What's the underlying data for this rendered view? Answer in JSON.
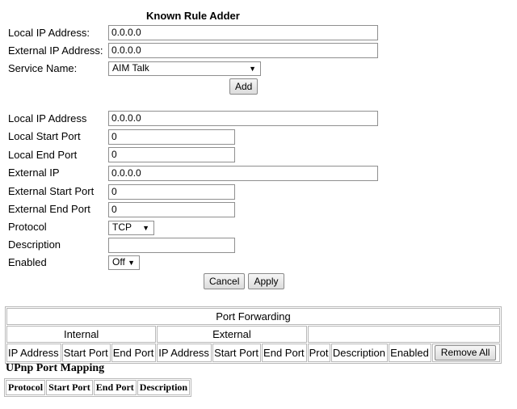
{
  "known_rule": {
    "title": "Known Rule Adder",
    "local_ip_label": "Local IP Address:",
    "local_ip_value": "0.0.0.0",
    "external_ip_label": "External IP Address:",
    "external_ip_value": "0.0.0.0",
    "service_label": "Service Name:",
    "service_value": "AIM Talk",
    "add_label": "Add"
  },
  "custom_rule": {
    "local_ip_label": "Local IP Address",
    "local_ip_value": "0.0.0.0",
    "local_start_label": "Local Start Port",
    "local_start_value": "0",
    "local_end_label": "Local End Port",
    "local_end_value": "0",
    "external_ip_label": "External IP",
    "external_ip_value": "0.0.0.0",
    "external_start_label": "External Start Port",
    "external_start_value": "0",
    "external_end_label": "External End Port",
    "external_end_value": "0",
    "protocol_label": "Protocol",
    "protocol_value": "TCP",
    "description_label": "Description",
    "description_value": "",
    "enabled_label": "Enabled",
    "enabled_value": "Off",
    "cancel_label": "Cancel",
    "apply_label": "Apply"
  },
  "port_forwarding": {
    "title": "Port Forwarding",
    "internal_label": "Internal",
    "external_label": "External",
    "columns": [
      "IP Address",
      "Start Port",
      "End Port",
      "IP Address",
      "Start Port",
      "End Port",
      "Prot",
      "Description",
      "Enabled"
    ],
    "remove_all_label": "Remove All"
  },
  "upnp": {
    "title": "UPnp Port Mapping",
    "columns": [
      "Protocol",
      "Start Port",
      "End Port",
      "Description"
    ]
  },
  "icons": {
    "dropdown": "chevron-down-icon"
  }
}
